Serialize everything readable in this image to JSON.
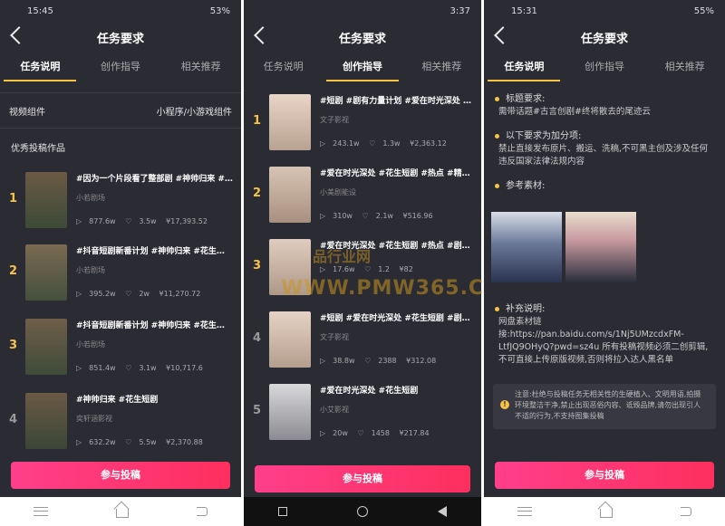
{
  "phone1": {
    "status": {
      "time": "15:45",
      "battery": "53%"
    },
    "title": "任务要求",
    "tabs": [
      "任务说明",
      "创作指导",
      "相关推荐"
    ],
    "component": {
      "label": "视频组件",
      "value": "小程序/小游戏组件"
    },
    "section_title": "优秀投稿作品",
    "items": [
      {
        "rank": "1",
        "title": "#因为一个片段看了整部剧 #神帅归来 #…",
        "author": "小若剧场",
        "plays": "877.6w",
        "likes": "3.5w",
        "earnings": "¥17,393.52"
      },
      {
        "rank": "2",
        "title": "#抖音短剧新番计划 #神帅归来 #花生…",
        "author": "小若剧场",
        "plays": "395.2w",
        "likes": "2w",
        "earnings": "¥11,270.72"
      },
      {
        "rank": "3",
        "title": "#抖音短剧新番计划 #神帅归来 #花生…",
        "author": "小若剧场",
        "plays": "851.4w",
        "likes": "3.1w",
        "earnings": "¥10,717.6"
      },
      {
        "rank": "4",
        "title": "#神帅归来 #花生短剧",
        "author": "奕轩涵影视",
        "plays": "632.2w",
        "likes": "5.5w",
        "earnings": "¥2,370.88"
      }
    ],
    "cta": "参与投稿"
  },
  "phone2": {
    "status": {
      "time": "3:37"
    },
    "title": "任务要求",
    "tabs": [
      "任务说明",
      "创作指导",
      "相关推荐"
    ],
    "items": [
      {
        "rank": "1",
        "title": "#短剧 #剧有力量计划 #爱在时光深处 #…",
        "author": "文子影视",
        "plays": "243.1w",
        "likes": "1.3w",
        "earnings": "¥2,363.12"
      },
      {
        "rank": "2",
        "title": "#爱在时光深处 #花生短剧 #热点 #精彩…",
        "author": "小美剧能设",
        "plays": "310w",
        "likes": "2.1w",
        "earnings": "¥516.96"
      },
      {
        "rank": "3",
        "title": "#爱在时光深处 #花生短剧 #热点 #剧有…",
        "author": "",
        "plays": "17.6w",
        "likes": "1.2",
        "earnings": "¥82"
      },
      {
        "rank": "4",
        "title": "#短剧 #爱在时光深处 #花生短剧 #剧有…",
        "author": "文子影视",
        "plays": "38.8w",
        "likes": "2388",
        "earnings": "¥312.08"
      },
      {
        "rank": "5",
        "title": "#爱在时光深处 #花生短剧",
        "author": "小艾影视",
        "plays": "20w",
        "likes": "1458",
        "earnings": "¥217.84"
      }
    ],
    "cta": "参与投稿",
    "watermark": "WWW.PMW365.COM",
    "watermark_cn": "品行业网"
  },
  "phone3": {
    "status": {
      "time": "15:31",
      "battery": "55%"
    },
    "title": "任务要求",
    "tabs": [
      "任务说明",
      "创作指导",
      "相关推荐"
    ],
    "req1_title": "标题要求:",
    "req1_text": "需带话题#古言创剧#终将散去的尾迹云",
    "req2_title": "以下要求为加分项:",
    "req2_text": "禁止直接发布原片、搬运、洗稿,不可黑主创及涉及任何违反国家法律法规内容",
    "ref_title": "参考素材:",
    "supp_title": "补充说明:",
    "supp_text": "网盘素材链接:https://pan.baidu.com/s/1Nj5UMzcdxFM-LtfJQ9OHyQ?pwd=sz4u 所有投稿视频必须二创剪辑,不可直接上传原版视频,否则将拉入达人黑名单",
    "notice": "注意:杜绝与投稿任务无相关性的生硬植入、文明用语,拍摄环境整洁干净,禁止出现恶俗内容、诋毁品牌,请勿出现引人不适的行为,不支持图集投稿",
    "cta": "参与投稿"
  }
}
